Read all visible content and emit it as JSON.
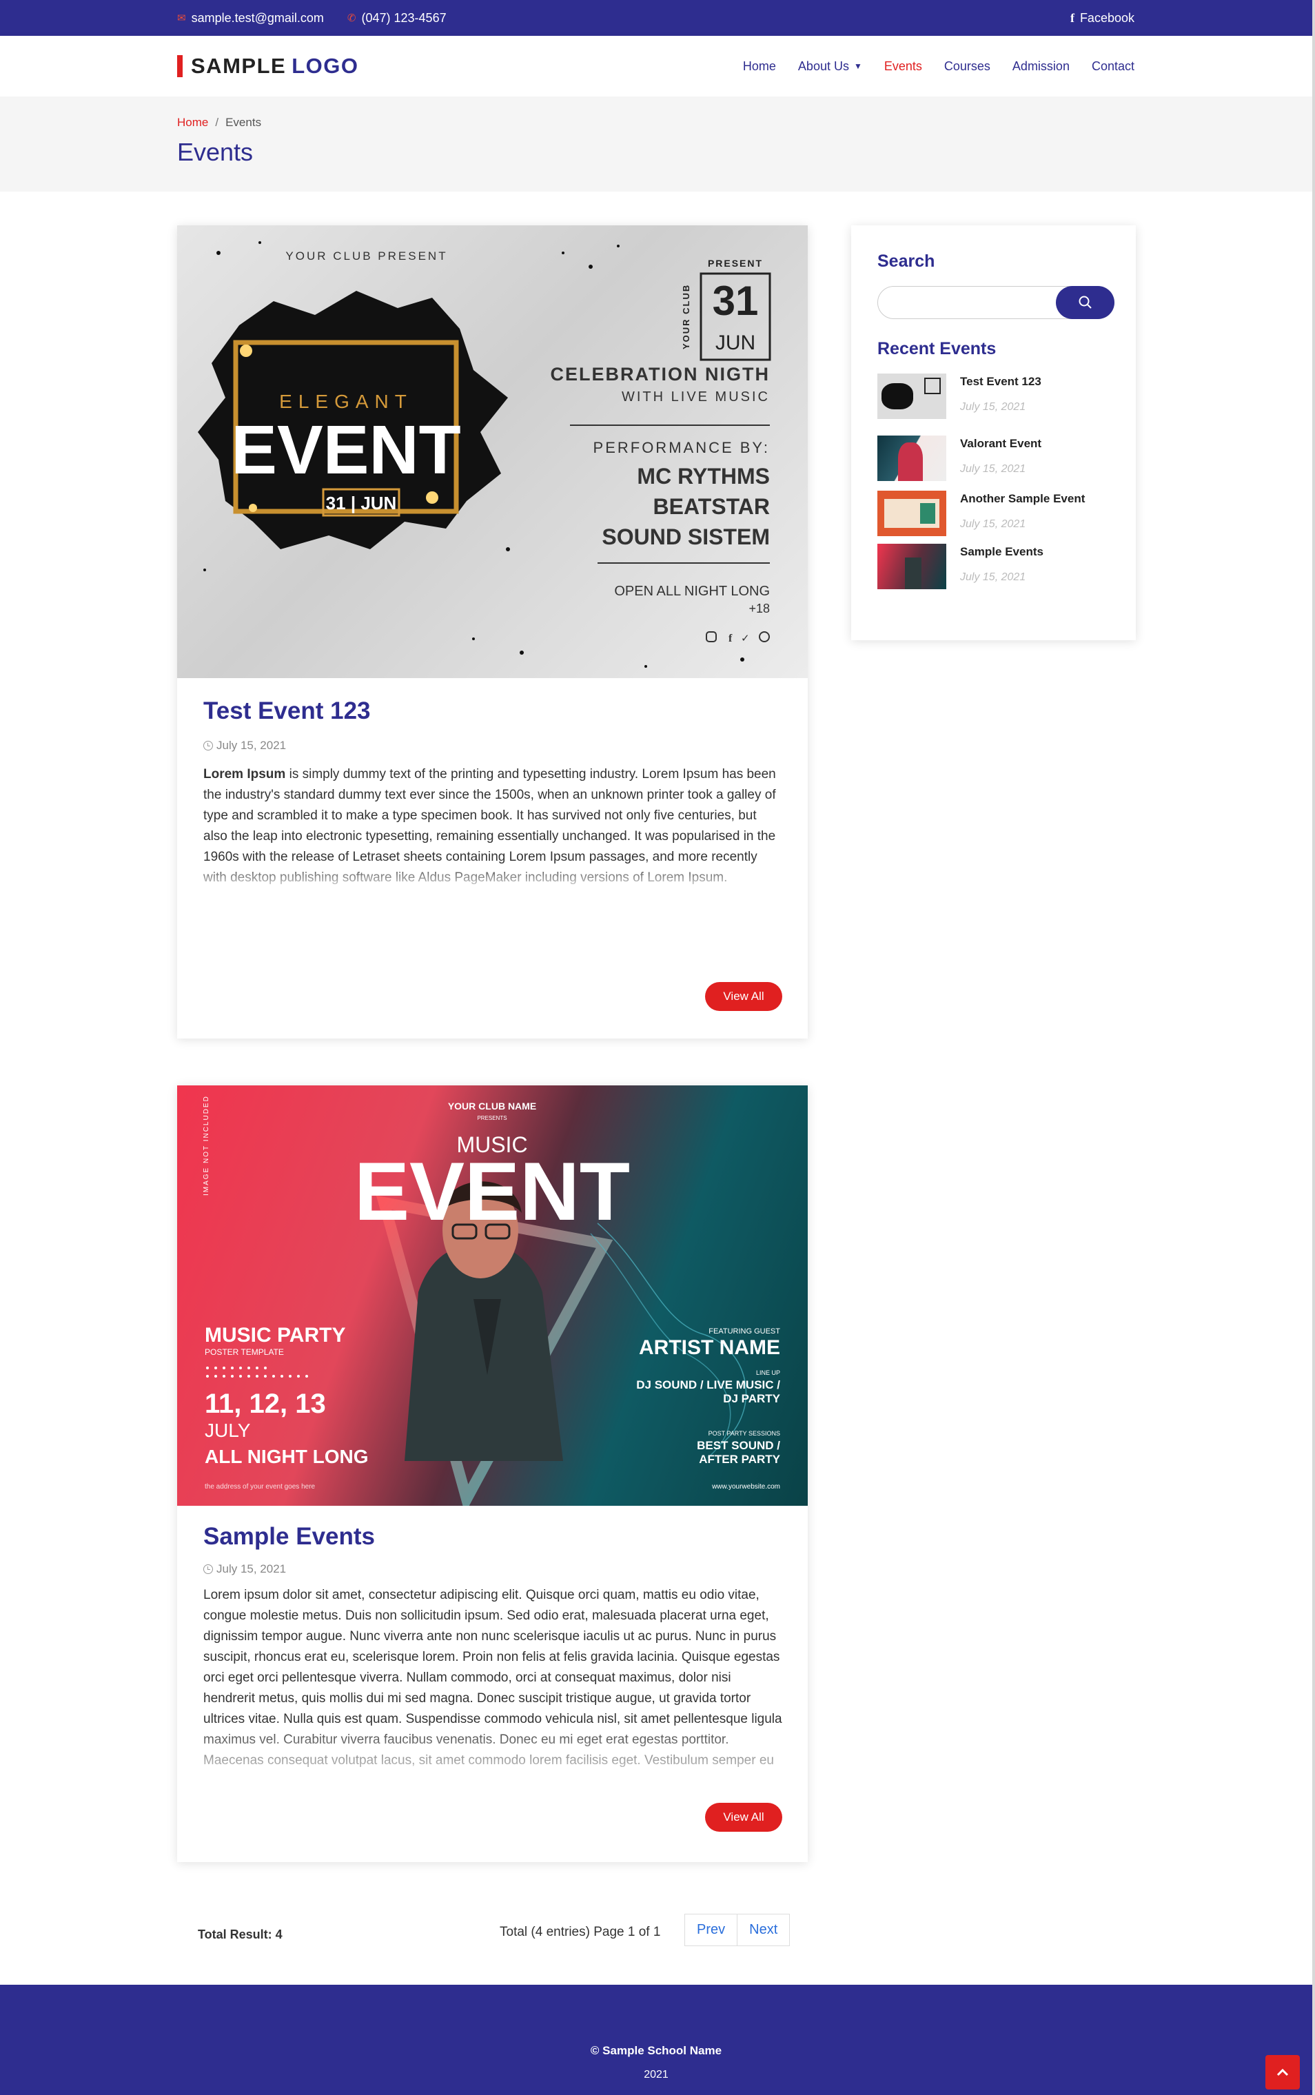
{
  "topbar": {
    "email": "sample.test@gmail.com",
    "phone": "(047) 123-4567",
    "facebook": "Facebook",
    "facebook_glyph": "f"
  },
  "header": {
    "logo_part1": "SAMPLE",
    "logo_part2": "LOGO"
  },
  "nav": [
    {
      "label": "Home",
      "active": false
    },
    {
      "label": "About Us",
      "active": false,
      "has_dropdown": true
    },
    {
      "label": "Events",
      "active": true
    },
    {
      "label": "Courses",
      "active": false
    },
    {
      "label": "Admission",
      "active": false
    },
    {
      "label": "Contact",
      "active": false
    }
  ],
  "breadcrumb": {
    "home": "Home",
    "separator": "/",
    "current": "Events"
  },
  "page_title": "Events",
  "posters": {
    "elegant": {
      "club": "YOUR CLUB PRESENT",
      "present": "PRESENT",
      "side": "YOUR CLUB",
      "day": "31",
      "month": "JUN",
      "celebration": "CELEBRATION NIGTH",
      "live": "WITH LIVE MUSIC",
      "perf": "PERFORMANCE BY:",
      "p1": "MC RYTHMS",
      "p2": "BEATSTAR",
      "p3": "SOUND SISTEM",
      "open": "OPEN ALL NIGHT LONG",
      "age": "+18",
      "word1": "ELEGANT",
      "word2": "EVENT",
      "date": "31 | JUN"
    },
    "music": {
      "club": "YOUR CLUB NAME",
      "presents": "PRESENTS",
      "side": "IMAGE NOT INCLUDED",
      "music": "MUSIC",
      "event": "EVENT",
      "party": "MUSIC PARTY",
      "template": "POSTER TEMPLATE",
      "dates": "11, 12, 13",
      "month": "JULY",
      "allnight": "ALL NIGHT LONG",
      "address": "the address of your event goes here",
      "featuring": "FEATURING GUEST",
      "artist": "ARTIST NAME",
      "lineup": "LINE UP",
      "dj1": "DJ SOUND / LIVE MUSIC /",
      "dj2": "DJ PARTY",
      "post": "POST PARTY SESSIONS",
      "best1": "BEST SOUND /",
      "best2": "AFTER PARTY",
      "web": "www.yourwebsite.com"
    }
  },
  "events": [
    {
      "title": "Test Event 123",
      "date": "July 15, 2021",
      "bold_lead": "Lorem Ipsum",
      "body": " is simply dummy text of the printing and typesetting industry. Lorem Ipsum has been the industry's standard dummy text ever since the 1500s, when an unknown printer took a galley of type and scrambled it to make a type specimen book. It has survived not only five centuries, but also the leap into electronic typesetting, remaining essentially unchanged. It was popularised in the 1960s with the release of Letraset sheets containing Lorem Ipsum passages, and more recently with desktop publishing software like Aldus PageMaker including versions of Lorem Ipsum.",
      "button": "View All"
    },
    {
      "title": "Sample Events",
      "date": "July 15, 2021",
      "body": "Lorem ipsum dolor sit amet, consectetur adipiscing elit. Quisque orci quam, mattis eu odio vitae, congue molestie metus. Duis non sollicitudin ipsum. Sed odio erat, malesuada placerat urna eget, dignissim tempor augue. Nunc viverra ante non nunc scelerisque iaculis ut ac purus. Nunc in purus suscipit, rhoncus erat eu, scelerisque lorem. Proin non felis at felis gravida lacinia. Quisque egestas orci eget orci pellentesque viverra. Nullam commodo, orci at consequat maximus, dolor nisi hendrerit metus, quis mollis dui mi sed magna. Donec suscipit tristique augue, ut gravida tortor ultrices vitae. Nulla quis est quam. Suspendisse commodo vehicula nisl, sit amet pellentesque ligula maximus vel. Curabitur viverra faucibus venenatis. Donec eu mi eget erat egestas porttitor. Maecenas consequat volutpat lacus, sit amet commodo lorem facilisis eget. Vestibulum semper eu",
      "button": "View All"
    }
  ],
  "sidebar": {
    "search_title": "Search",
    "search_placeholder": "",
    "recent_title": "Recent Events",
    "recent": [
      {
        "name": "Test Event 123",
        "date": "July 15, 2021"
      },
      {
        "name": "Valorant Event",
        "date": "July 15, 2021"
      },
      {
        "name": "Another Sample Event",
        "date": "July 15, 2021"
      },
      {
        "name": "Sample Events",
        "date": "July 15, 2021"
      }
    ]
  },
  "pagination": {
    "total_result": "Total Result: 4",
    "info": "Total (4 entries)  Page 1 of 1",
    "prev": "Prev",
    "next": "Next"
  },
  "footer": {
    "name": "© Sample School Name",
    "year": "2021"
  },
  "colors": {
    "primary": "#2e2d8f",
    "accent": "#e02020"
  }
}
